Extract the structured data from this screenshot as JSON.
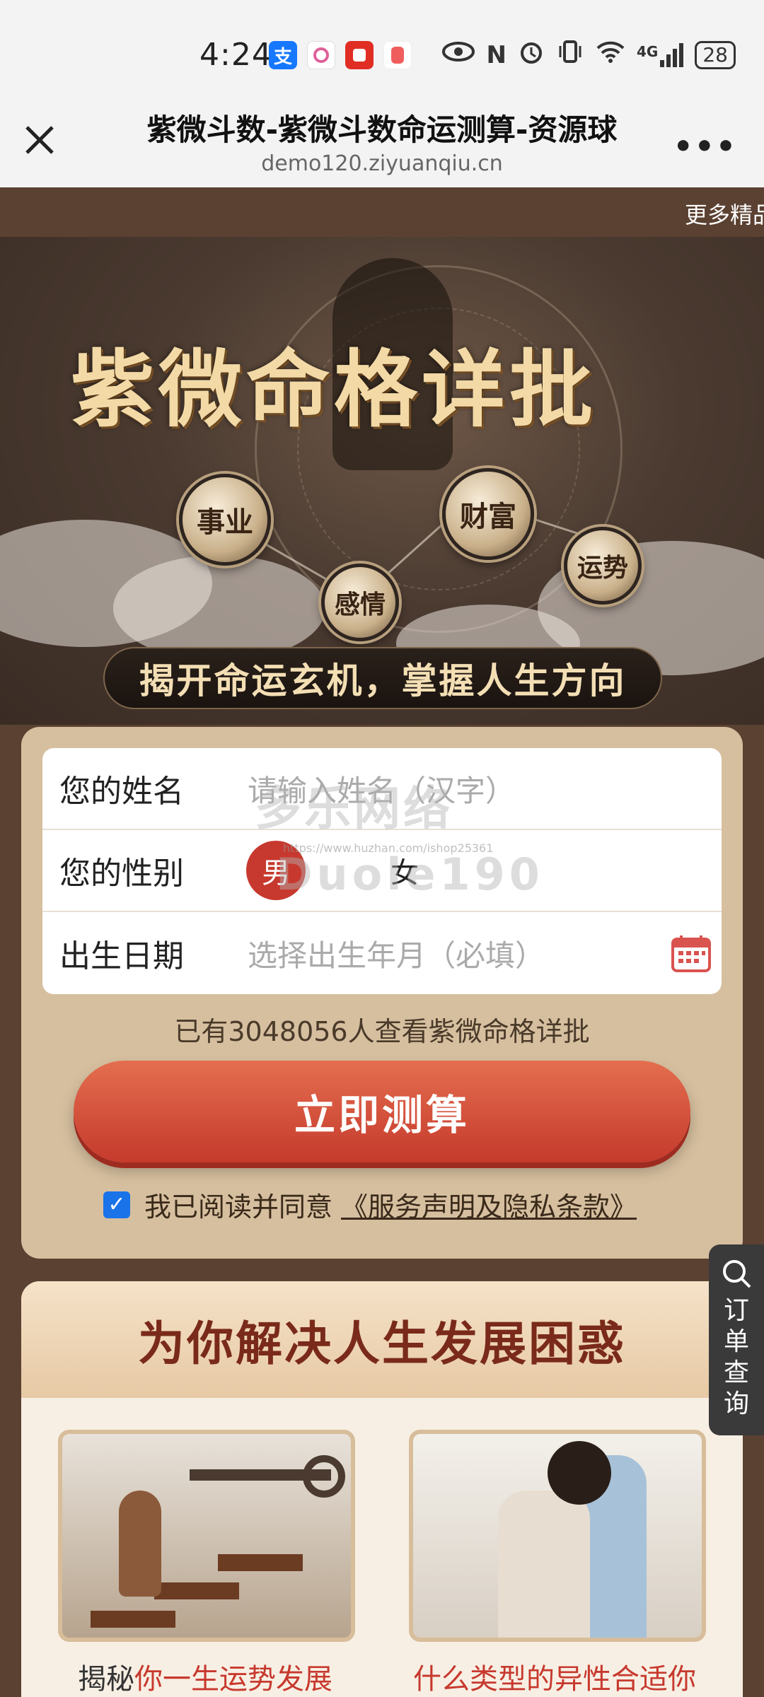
{
  "status_bar": {
    "time": "4:24",
    "battery": "28",
    "network": "4G"
  },
  "browser": {
    "title": "紫微斗数-紫微斗数命运测算-资源球",
    "url": "demo120.ziyuanqiu.cn",
    "more": "•••"
  },
  "marquee": {
    "text": "更多精品"
  },
  "banner": {
    "title": "紫微命格详批",
    "orbs": [
      "事业",
      "财富",
      "感情",
      "运势"
    ],
    "slogan": "揭开命运玄机，掌握人生方向"
  },
  "form": {
    "name_label": "您的姓名",
    "name_placeholder": "请输入姓名（汉字）",
    "gender_label": "您的性别",
    "gender_male": "男",
    "gender_female": "女",
    "birth_label": "出生日期",
    "birth_placeholder": "选择出生年月（必填）",
    "viewers": "已有3048056人查看紫微命格详批",
    "submit": "立即测算",
    "agree_text": "我已阅读并同意",
    "agree_link": "《服务声明及隐私条款》"
  },
  "watermark": {
    "line1": "多乐网络",
    "line2": "Duole190",
    "url": "https://www.huzhan.com/ishop25361"
  },
  "order_query": {
    "label": "订单查询"
  },
  "info": {
    "title": "为你解决人生发展困惑",
    "left_caption_dark": "揭秘",
    "left_caption_red": "你一生运势发展",
    "right_caption": "什么类型的异性合适你"
  },
  "colors": {
    "brand_brown": "#5b4131",
    "accent_red": "#c7392e",
    "card_tan": "#d6bf9f"
  }
}
